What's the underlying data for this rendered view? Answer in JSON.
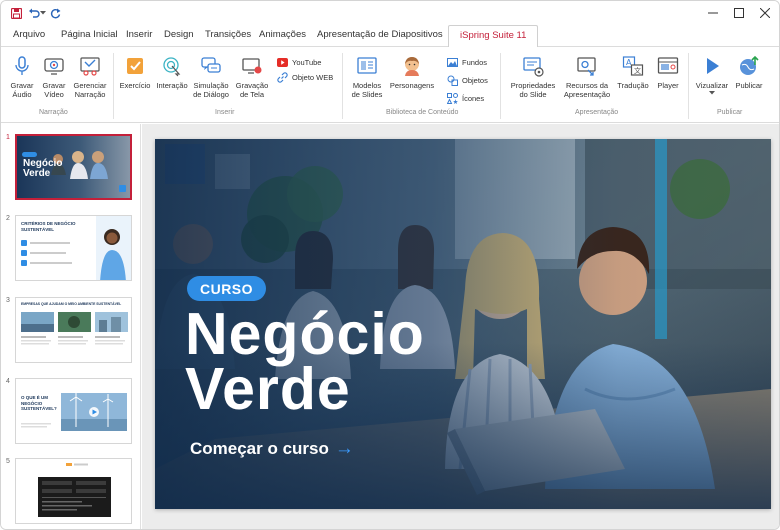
{
  "menu": {
    "tabs": [
      {
        "label": "Arquivo"
      },
      {
        "label": "Página Inicial"
      },
      {
        "label": "Inserir"
      },
      {
        "label": "Design"
      },
      {
        "label": "Transições"
      },
      {
        "label": "Animações"
      },
      {
        "label": "Apresentação de Diapositivos"
      },
      {
        "label": "iSpring Suite 11"
      }
    ],
    "active_index": 7
  },
  "ribbon": {
    "narracao": {
      "group": "Narração",
      "items": [
        {
          "label": "Gravar\nÁudio",
          "icon": "microphone-icon"
        },
        {
          "label": "Gravar\nVídeo",
          "icon": "webcam-icon"
        },
        {
          "label": "Gerenciar\nNarração",
          "icon": "manage-narration-icon"
        }
      ]
    },
    "inserir": {
      "group": "Inserir",
      "items": [
        {
          "label": "Exercício",
          "icon": "quiz-icon"
        },
        {
          "label": "Interação",
          "icon": "interaction-icon"
        },
        {
          "label": "Simulação\nde Diálogo",
          "icon": "dialog-simulation-icon"
        },
        {
          "label": "Gravação\nde Tela",
          "icon": "screen-recording-icon"
        }
      ],
      "small": [
        {
          "label": "YouTube",
          "icon": "youtube-icon"
        },
        {
          "label": "Objeto WEB",
          "icon": "web-object-icon"
        }
      ]
    },
    "biblioteca": {
      "group": "Biblioteca de Conteúdo",
      "items": [
        {
          "label": "Modelos\nde Slides",
          "icon": "slide-templates-icon"
        },
        {
          "label": "Personagens",
          "icon": "characters-icon"
        }
      ],
      "small": [
        {
          "label": "Fundos",
          "icon": "backgrounds-icon"
        },
        {
          "label": "Objetos",
          "icon": "objects-icon"
        },
        {
          "label": "Ícones",
          "icon": "icons-icon"
        }
      ]
    },
    "apresentacao": {
      "group": "Apresentação",
      "items": [
        {
          "label": "Propriedades\ndo Slide",
          "icon": "slide-properties-icon"
        },
        {
          "label": "Recursos da\nApresentação",
          "icon": "presentation-resources-icon"
        },
        {
          "label": "Tradução",
          "icon": "translation-icon"
        },
        {
          "label": "Player",
          "icon": "player-icon"
        }
      ]
    },
    "publicar": {
      "group": "Publicar",
      "items": [
        {
          "label": "Vizualizar",
          "icon": "preview-icon"
        },
        {
          "label": "Publicar",
          "icon": "publish-icon"
        }
      ]
    }
  },
  "thumbnails": [
    {
      "number": "1",
      "title": "Negócio\nVerde",
      "selected": true
    },
    {
      "number": "2",
      "title": "CRITÉRIOS DE NEGÓCIO SUSTENTÁVEL"
    },
    {
      "number": "3",
      "title": "EMPRESAS QUE AJUDAM O MEIO AMBIENTE SUSTENTÁVEL"
    },
    {
      "number": "4",
      "title": "O QUE É UM NEGÓCIO SUSTENTÁVEL?"
    },
    {
      "number": "5",
      "title": ""
    }
  ],
  "slide": {
    "badge": "CURSO",
    "title_line1": "Negócio",
    "title_line2": "Verde",
    "cta": "Começar o curso",
    "cta_arrow": "→"
  },
  "colors": {
    "accent": "#c4203a",
    "badge": "#2f8de4",
    "icon_blue": "#3b7fd4",
    "icon_orange": "#f2a23a"
  }
}
